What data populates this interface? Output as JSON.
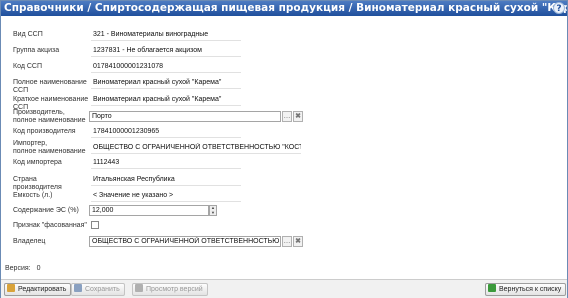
{
  "title": "Справочники / Спиртосодержащая пищевая продукция / Виноматериал красный сухой \"Карема\"",
  "help": "?",
  "fields": {
    "vid_ssp": {
      "label": "Вид ССП",
      "value": "321 - Виноматериалы виноградные"
    },
    "gruppa": {
      "label": "Группа акциза",
      "value": "1237831 - Не облагается акцизом"
    },
    "kod_ssp": {
      "label": "Код ССП",
      "value": "017841000001231078"
    },
    "full_name": {
      "label": "Полное наименование ССП",
      "value": "Виноматериал красный сухой \"Карема\""
    },
    "short_name": {
      "label": "Краткое наименование ССП",
      "value": "Виноматериал красный сухой \"Карема\""
    },
    "producer": {
      "label1": "Производитель,",
      "label2": "полное наименование",
      "value": "Порто"
    },
    "producer_code": {
      "label": "Код производителя",
      "value": "17841000001230965"
    },
    "importer": {
      "label1": "Импортер,",
      "label2": "полное наименование",
      "value": "ОБЩЕСТВО С ОГРАНИЧЕННОЙ ОТВЕТСТВЕННОСТЬЮ \"КОСТА\""
    },
    "importer_code": {
      "label": "Код импортера",
      "value": "1112443"
    },
    "country": {
      "label": "Страна производителя",
      "value": "Итальянская Республика"
    },
    "capacity": {
      "label": "Емкость (л.)",
      "value": "< Значение не указано >"
    },
    "es": {
      "label": "Содержание ЭС (%)",
      "value": "12,000"
    },
    "packed": {
      "label": "Признак \"фасованная\"",
      "checked": false
    },
    "owner": {
      "label": "Владелец",
      "value": "ОБЩЕСТВО С ОГРАНИЧЕННОЙ ОТВЕТСТВЕННОСТЬЮ \"КОС"
    }
  },
  "version": {
    "label": "Версия:",
    "value": "0"
  },
  "buttons": {
    "edit": "Редактировать",
    "save": "Сохранить",
    "versions": "Просмотр версий",
    "back": "Вернуться к списку"
  },
  "icons": {
    "select": "ellipsis-icon",
    "clear": "clear-x-icon",
    "spin_up": "spin-up-icon",
    "spin_down": "spin-down-icon"
  },
  "colors": {
    "titlebar": "#2a5aa8",
    "edit_icon": "#d9a33a",
    "save_icon": "#8aa0c0",
    "versions_icon": "#b0b0b0",
    "back_icon": "#3c9a3c"
  }
}
